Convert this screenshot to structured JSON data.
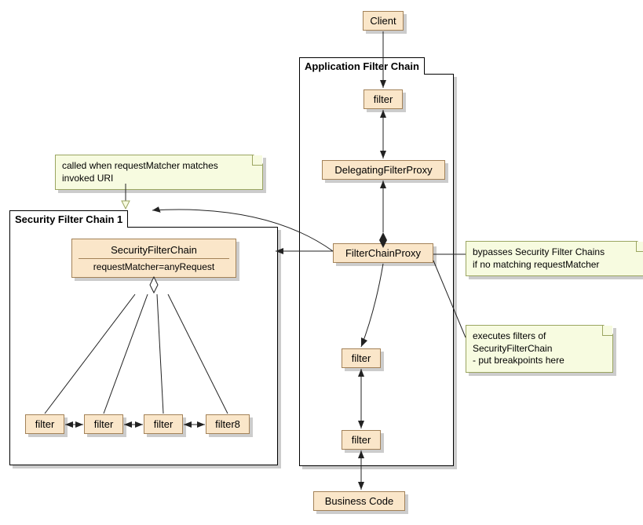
{
  "client": "Client",
  "appChain": {
    "title": "Application Filter Chain",
    "f1": "filter",
    "delegating": "DelegatingFilterProxy",
    "proxy": "FilterChainProxy",
    "f2": "filter",
    "f3": "filter"
  },
  "businessCode": "Business Code",
  "secChain": {
    "title": "Security Filter Chain 1",
    "header": "SecurityFilterChain",
    "body": "requestMatcher=anyRequest",
    "sf1": "filter",
    "sf2": "filter",
    "sf3": "filter",
    "sf4": "filter8"
  },
  "notes": {
    "calledWhen": "called when requestMatcher matches\ninvoked URI",
    "bypasses": "bypasses Security Filter Chains\nif no matching requestMatcher",
    "executes": "executes filters of\n SecurityFilterChain\n- put breakpoints here"
  }
}
